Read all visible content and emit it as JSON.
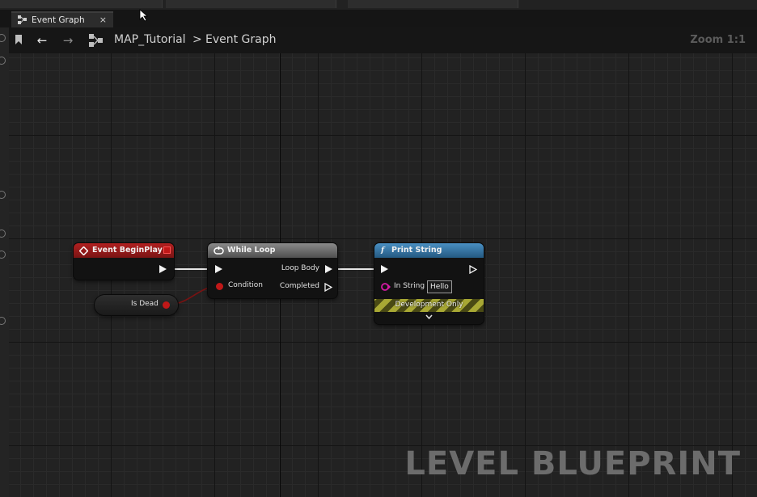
{
  "tab": {
    "label": "Event Graph",
    "close": "×"
  },
  "breadcrumb": {
    "back": "←",
    "forward": "→",
    "map": "MAP_Tutorial",
    "separator": ">",
    "graph": "Event Graph"
  },
  "zoom": "Zoom 1:1",
  "nodes": {
    "event_begin_play": {
      "title": "Event BeginPlay"
    },
    "while_loop": {
      "title": "While Loop",
      "condition": "Condition",
      "loop_body": "Loop Body",
      "completed": "Completed"
    },
    "print_string": {
      "title": "Print String",
      "in_string": "In String",
      "in_string_value": "Hello",
      "dev_only": "Development Only"
    },
    "is_dead": {
      "label": "Is Dead"
    }
  },
  "watermark": "LEVEL BLUEPRINT",
  "colors": {
    "event_header": "#9b1a1a",
    "while_header": "#5b5b5b",
    "print_header": "#2f6a94",
    "bool_pin": "#c01818",
    "string_pin": "#d61aa6"
  }
}
